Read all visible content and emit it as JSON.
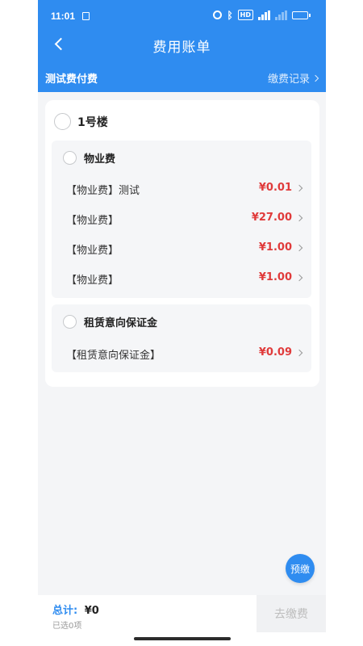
{
  "status_bar": {
    "time": "11:01",
    "icons": [
      "notification-icon",
      "alarm-icon",
      "bluetooth-icon",
      "hd-icon",
      "signal-5g-icon",
      "signal-icon",
      "battery-icon"
    ]
  },
  "nav": {
    "title": "费用账单"
  },
  "subheader": {
    "title": "测试费付费",
    "records_link": "缴费记录"
  },
  "building": {
    "name": "1号楼",
    "groups": [
      {
        "title": "物业费",
        "items": [
          {
            "label": "【物业费】测试",
            "amount": "¥0.01"
          },
          {
            "label": "【物业费】",
            "amount": "¥27.00"
          },
          {
            "label": "【物业费】",
            "amount": "¥1.00"
          },
          {
            "label": "【物业费】",
            "amount": "¥1.00"
          }
        ]
      },
      {
        "title": "租赁意向保证金",
        "items": [
          {
            "label": "【租赁意向保证金】",
            "amount": "¥0.09"
          }
        ]
      }
    ]
  },
  "prepay_label": "预缴",
  "footer": {
    "total_label": "总计:",
    "total_value": "¥0",
    "selected_text": "已选0项",
    "pay_button": "去缴费"
  },
  "colors": {
    "primary": "#2f8cf0",
    "amount": "#e03b3b",
    "background": "#f4f5f7"
  }
}
